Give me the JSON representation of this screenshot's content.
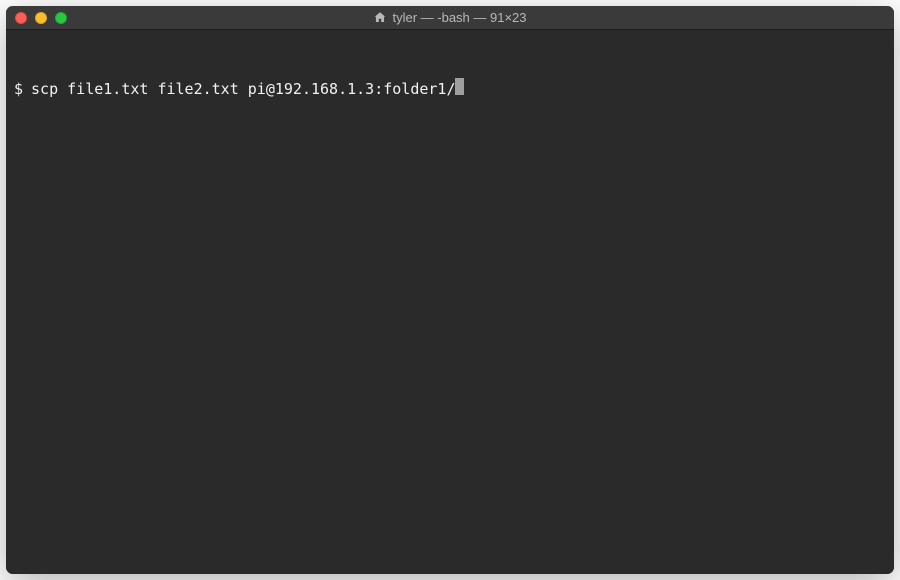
{
  "titlebar": {
    "title": "tyler — -bash — 91×23",
    "icon": "home-icon"
  },
  "terminal": {
    "prompt": "$",
    "command": "scp file1.txt file2.txt pi@192.168.1.3:folder1/"
  },
  "colors": {
    "background": "#2a2a2a",
    "titlebar": "#3a3a3a",
    "text": "#f2f2f2",
    "close": "#ff5f57",
    "minimize": "#ffbd2e",
    "maximize": "#28c940"
  }
}
